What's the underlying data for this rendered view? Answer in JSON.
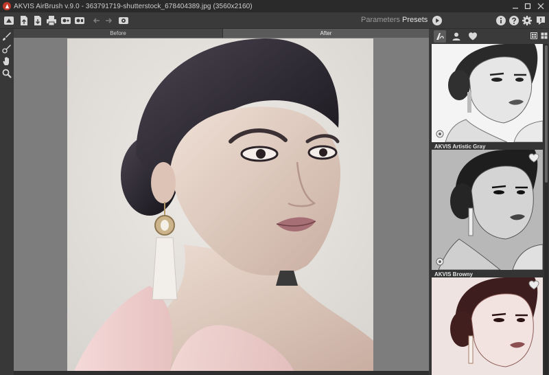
{
  "window": {
    "title": "AKVIS AirBrush v.9.0 - 363791719-shutterstock_678404389.jpg (3560x2160)",
    "controls": [
      "minimize-icon",
      "maximize-icon",
      "close-icon"
    ]
  },
  "toolbar": {
    "left_icons": [
      "home-icon",
      "open-file-icon",
      "save-file-icon",
      "print-icon",
      "before-after-icon",
      "batch-icon",
      "undo-icon",
      "redo-icon",
      "process-settings-icon"
    ],
    "tabs": {
      "parameters": "Parameters",
      "presets": "Presets"
    },
    "right_icons": [
      "run-icon",
      "info-icon",
      "help-icon",
      "settings-icon",
      "notifications-icon"
    ]
  },
  "tools": [
    "brush-icon",
    "restore-brush-icon",
    "hand-icon",
    "zoom-icon"
  ],
  "canvas": {
    "tab_before": "Before",
    "tab_after": "After",
    "active_tab": "after"
  },
  "presets_panel": {
    "categories": [
      "airbrush-category-icon",
      "portrait-category-icon",
      "favorites-category-icon"
    ],
    "view_modes": [
      "grid-view-icon",
      "large-view-icon"
    ],
    "items": [
      {
        "label": "",
        "style": "pencil"
      },
      {
        "label": "AKVIS Artistic Gray",
        "style": "gray"
      },
      {
        "label": "AKVIS Browny",
        "style": "browny"
      }
    ]
  },
  "colors": {
    "background": "#3c3c3c",
    "titlebar": "#2a2a2a",
    "canvas_bg": "#7d7d7d",
    "accent_red": "#c0392b"
  }
}
